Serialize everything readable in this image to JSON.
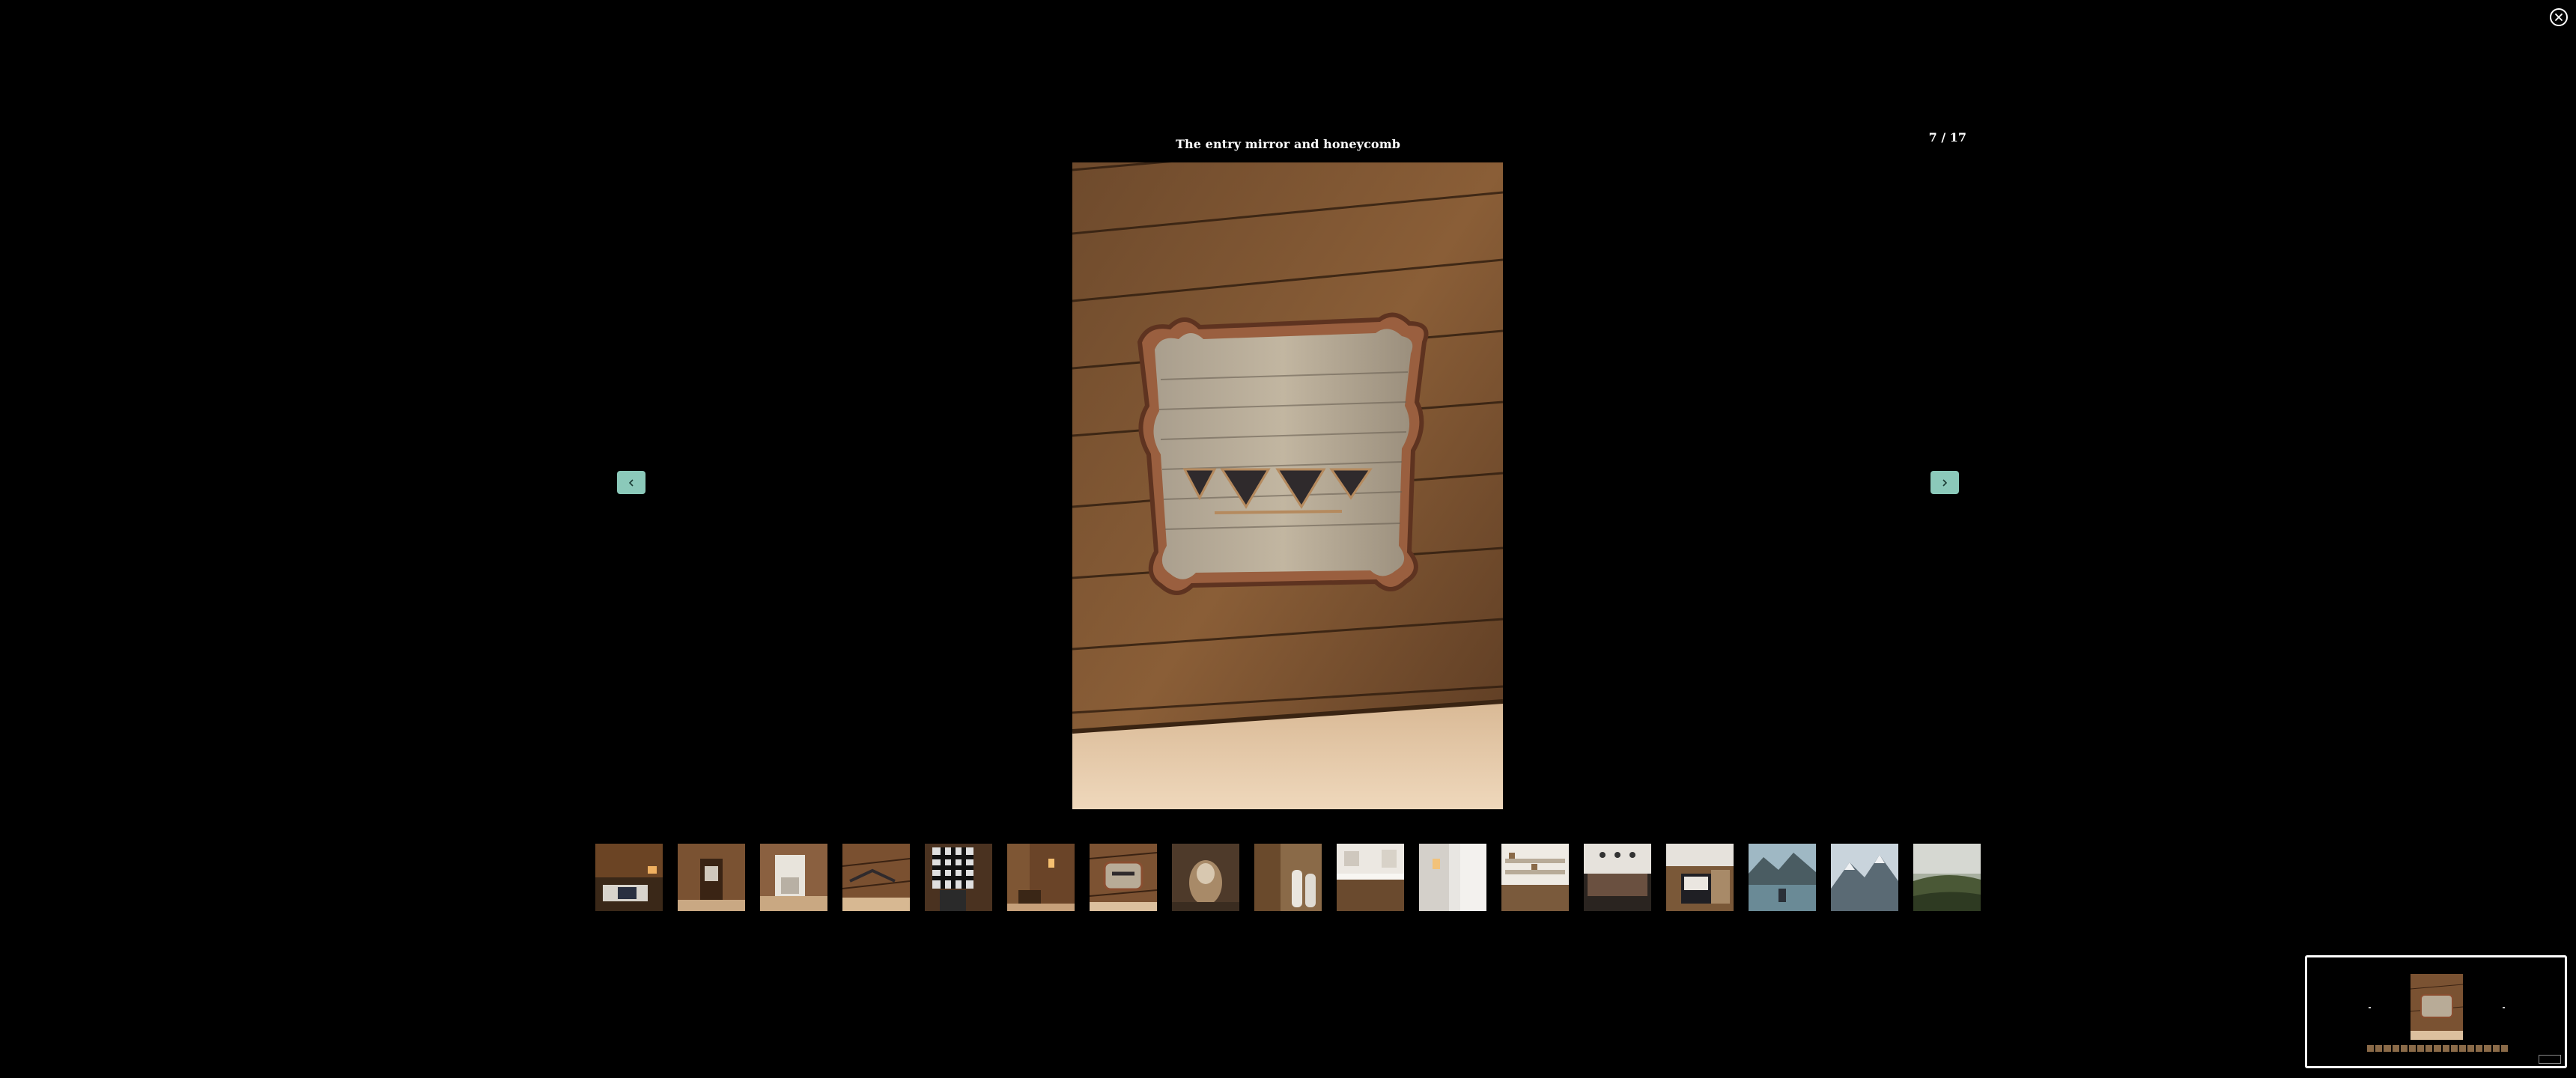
{
  "viewer": {
    "caption": "The entry mirror and honeycomb",
    "counter": "7 / 17",
    "close_icon": "close-icon",
    "prev_icon": "chevron-left-icon",
    "next_icon": "chevron-right-icon",
    "accent_color": "#8bc9ba",
    "current_index": 7,
    "total": 17
  }
}
